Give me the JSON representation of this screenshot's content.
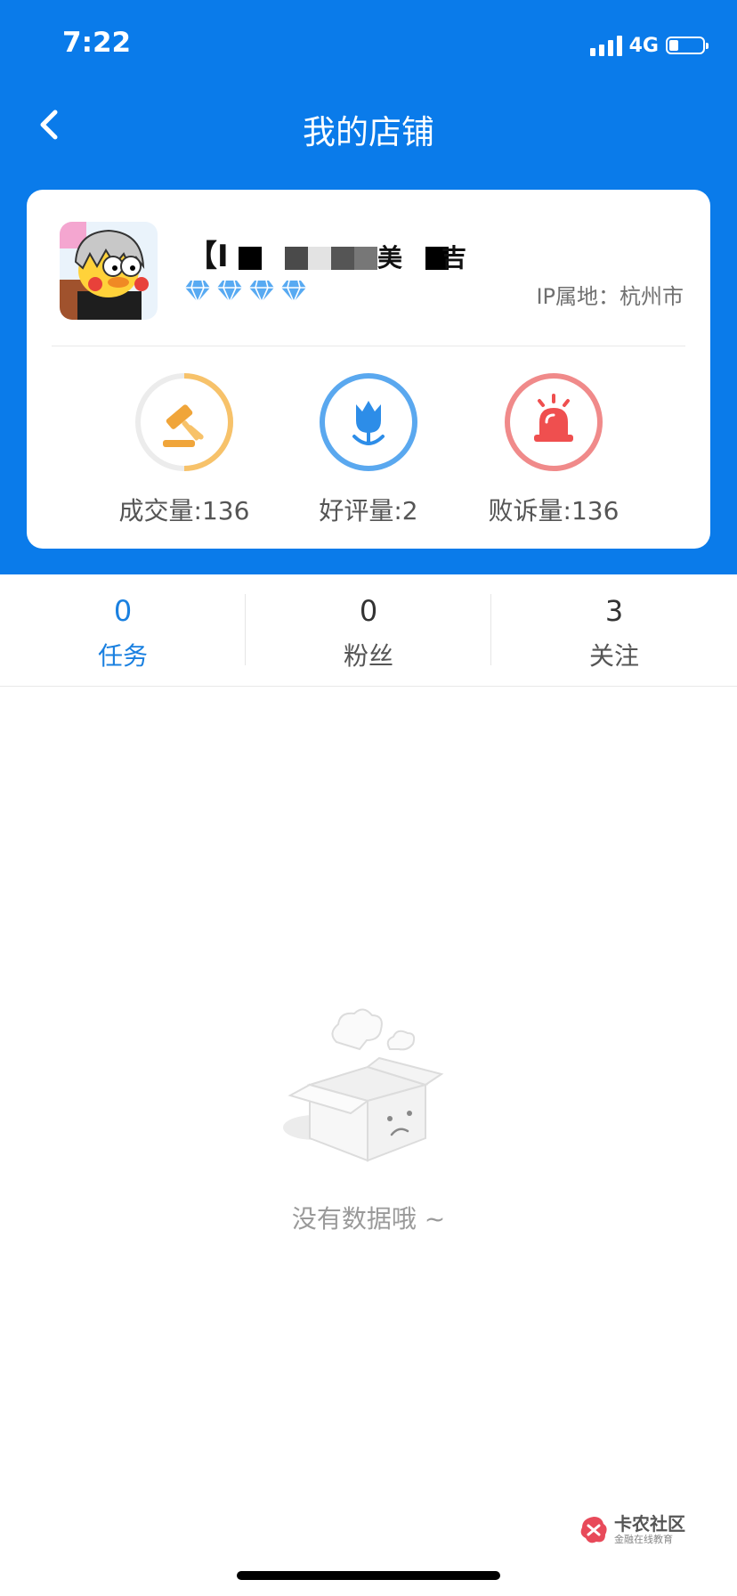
{
  "status_bar": {
    "time": "7:22",
    "network": "4G",
    "signal_bars": 4,
    "battery_level": 0.25
  },
  "header": {
    "title": "我的店铺",
    "back_icon": "chevron-left-icon"
  },
  "shop": {
    "name": "【I ■ ■■■ 美 ■吉",
    "diamond_count": 4,
    "ip_location": "IP属地：杭州市",
    "stats": [
      {
        "label": "成交量:136",
        "icon": "gavel-icon",
        "ring_color": "#f7c26a",
        "ring_progress": 0.5
      },
      {
        "label": "好评量:2",
        "icon": "tulip-icon",
        "ring_color": "#5aa8ef",
        "ring_progress": 1
      },
      {
        "label": "败诉量:136",
        "icon": "alarm-icon",
        "ring_color": "#f08a8a",
        "ring_progress": 1
      }
    ]
  },
  "tabs": [
    {
      "count": "0",
      "label": "任务",
      "active": true
    },
    {
      "count": "0",
      "label": "粉丝",
      "active": false
    },
    {
      "count": "3",
      "label": "关注",
      "active": false
    }
  ],
  "empty_state": {
    "text": "没有数据哦 ~",
    "icon": "empty-box-icon"
  },
  "watermark": {
    "title": "卡农社区",
    "subtitle": "金融在线教育"
  },
  "colors": {
    "primary": "#0a7bea",
    "tab_active": "#1a80e0"
  }
}
